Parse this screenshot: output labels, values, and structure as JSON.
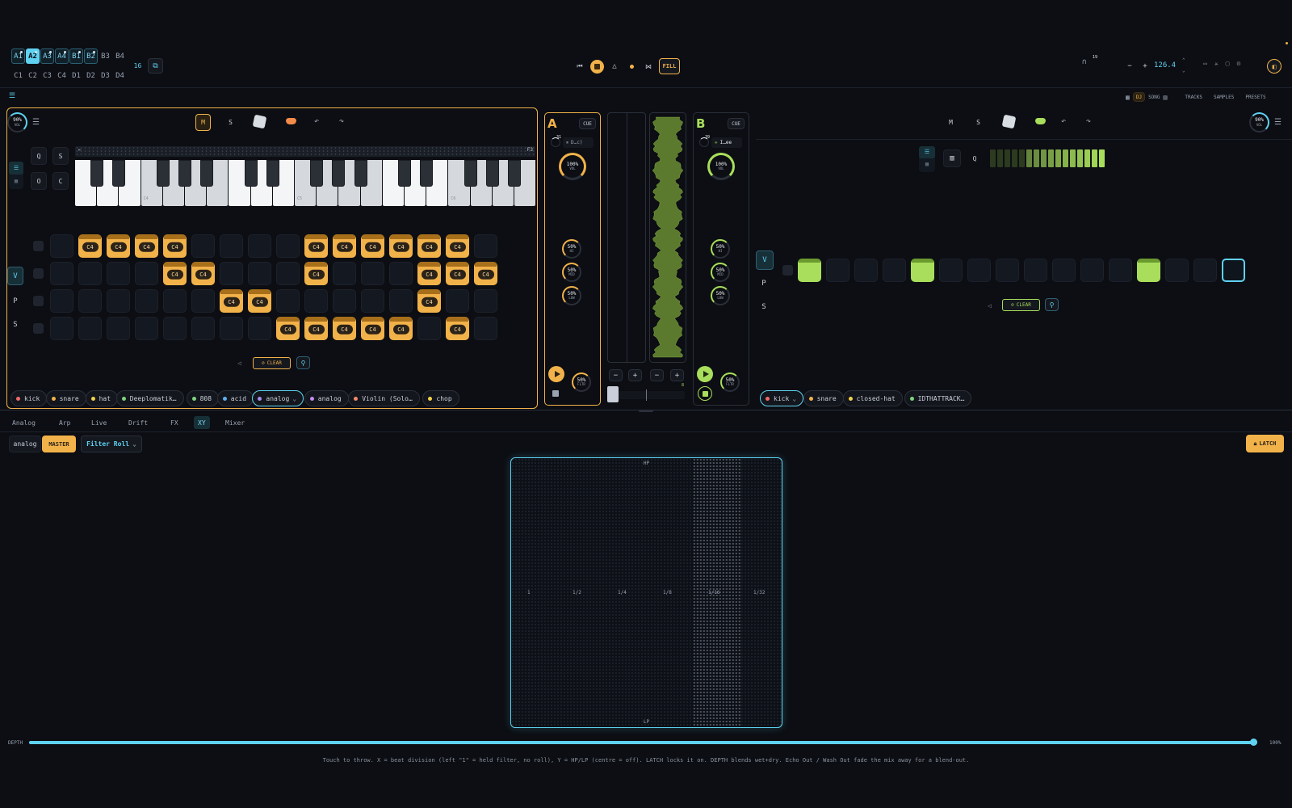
{
  "patterns": {
    "rows": [
      [
        {
          "label": "A1",
          "state": "sel"
        },
        {
          "label": "A2",
          "state": "act"
        },
        {
          "label": "A3",
          "state": "sel"
        },
        {
          "label": "A4",
          "state": "sel"
        },
        {
          "label": "B1",
          "state": "sel"
        },
        {
          "label": "B2",
          "state": "sel"
        },
        {
          "label": "B3",
          "state": ""
        },
        {
          "label": "B4",
          "state": ""
        }
      ],
      [
        {
          "label": "C1",
          "state": ""
        },
        {
          "label": "C2",
          "state": ""
        },
        {
          "label": "C3",
          "state": ""
        },
        {
          "label": "C4",
          "state": ""
        },
        {
          "label": "D1",
          "state": ""
        },
        {
          "label": "D2",
          "state": ""
        },
        {
          "label": "D3",
          "state": ""
        },
        {
          "label": "D4",
          "state": ""
        }
      ]
    ],
    "length": "16"
  },
  "transport": {
    "fill_label": "FILL"
  },
  "tempo": {
    "bpm": "126.4",
    "headphone_badge": "19"
  },
  "view_modes": {
    "dj": "DJ",
    "song": "SONG",
    "tracks": "TRACKS",
    "samples": "SAMPLES",
    "presets": "PRESETS"
  },
  "deck_a": {
    "vol": "90%",
    "vol_unit": "VOL",
    "mute": "M",
    "solo": "S",
    "grid_buttons": [
      "Q",
      "S",
      "O",
      "C"
    ],
    "octave_end": "F3",
    "octave_labels": [
      "C4",
      "C5",
      "C6"
    ],
    "row_labels": [
      "V",
      "P",
      "S"
    ],
    "note": "C4",
    "steps": [
      [
        0,
        1,
        1,
        1,
        1,
        0,
        0,
        0,
        0,
        1,
        1,
        1,
        1,
        1,
        1,
        0
      ],
      [
        0,
        0,
        0,
        0,
        1,
        1,
        0,
        0,
        0,
        1,
        0,
        0,
        0,
        1,
        1,
        1
      ],
      [
        0,
        0,
        0,
        0,
        0,
        0,
        1,
        1,
        0,
        0,
        0,
        0,
        0,
        1,
        0,
        0
      ],
      [
        0,
        0,
        0,
        0,
        0,
        0,
        0,
        0,
        1,
        1,
        1,
        1,
        1,
        0,
        1,
        0
      ]
    ],
    "clear_label": "CLEAR",
    "tracks": [
      {
        "name": "kick",
        "color": "#f06a6a"
      },
      {
        "name": "snare",
        "color": "#f2b24a"
      },
      {
        "name": "hat",
        "color": "#f2d24a"
      },
      {
        "name": "Deeplomatik…",
        "color": "#7fd37f"
      },
      {
        "name": "808",
        "color": "#7fd37f"
      },
      {
        "name": "acid",
        "color": "#5fb0f2"
      },
      {
        "name": "analog",
        "color": "#a88bf2",
        "selected": true
      },
      {
        "name": "analog",
        "color": "#c48bf2"
      },
      {
        "name": "Violin (Solo…",
        "color": "#f28b6a"
      },
      {
        "name": "chop",
        "color": "#f2d24a"
      }
    ]
  },
  "mixer": {
    "a": {
      "letter": "A",
      "cue": "CUE",
      "badge": "31",
      "track": "D…c)",
      "vol": "100%",
      "vol_unit": "VOL",
      "eq": [
        {
          "v": "50%",
          "l": "HI"
        },
        {
          "v": "50%",
          "l": "MID"
        },
        {
          "v": "50%",
          "l": "LOW"
        }
      ],
      "filter": "50%",
      "filter_unit": "FLTR"
    },
    "b": {
      "letter": "B",
      "cue": "CUE",
      "badge": "39",
      "track": "I…ee",
      "vol": "100%",
      "vol_unit": "VOL",
      "eq": [
        {
          "v": "50%",
          "l": "HI"
        },
        {
          "v": "50%",
          "l": "MID"
        },
        {
          "v": "50%",
          "l": "LOW"
        }
      ],
      "filter": "50%",
      "filter_unit": "FLTR"
    },
    "nudge": {
      "minus": "−",
      "plus": "+",
      "count": "8"
    }
  },
  "deck_b": {
    "vol": "90%",
    "vol_unit": "VOL",
    "mute": "M",
    "solo": "S",
    "quantize": "Q",
    "row_labels": [
      "V",
      "P",
      "S"
    ],
    "steps": [
      1,
      0,
      0,
      0,
      1,
      0,
      0,
      0,
      0,
      0,
      0,
      0,
      1,
      0,
      0,
      0
    ],
    "cursor_step": 15,
    "level_bars": 16,
    "clear_label": "CLEAR",
    "tracks": [
      {
        "name": "kick",
        "color": "#f06a6a",
        "selected": true
      },
      {
        "name": "snare",
        "color": "#f2b24a"
      },
      {
        "name": "closed-hat",
        "color": "#f2d24a"
      },
      {
        "name": "IDTHATTRACK…",
        "color": "#7fd37f"
      }
    ]
  },
  "fx_tabs": [
    {
      "label": "Analog"
    },
    {
      "label": "Arp"
    },
    {
      "label": "Live"
    },
    {
      "label": "Drift"
    },
    {
      "label": "FX"
    },
    {
      "label": "XY",
      "selected": true
    },
    {
      "label": "Mixer"
    }
  ],
  "fx": {
    "target": "analog",
    "master": "MASTER",
    "mode": "Filter Roll",
    "latch": "LATCH",
    "xy": {
      "top": "HP",
      "bottom": "LP",
      "divisions": [
        "1",
        "1/2",
        "1/4",
        "1/8",
        "1/16",
        "1/32"
      ]
    },
    "depth_label": "DEPTH",
    "depth_value": "100%",
    "depth": 1.0,
    "help": "Touch to throw. X = beat division (left \"1\" = held filter, no roll), Y = HP/LP (centre = off). LATCH locks it on. DEPTH blends wet+dry. Echo Out / Wash Out fade the mix away for a blend-out."
  },
  "colors": {
    "accent_a": "#f2b24a",
    "accent_b": "#a8de5b",
    "cyan": "#5fd2f2"
  }
}
